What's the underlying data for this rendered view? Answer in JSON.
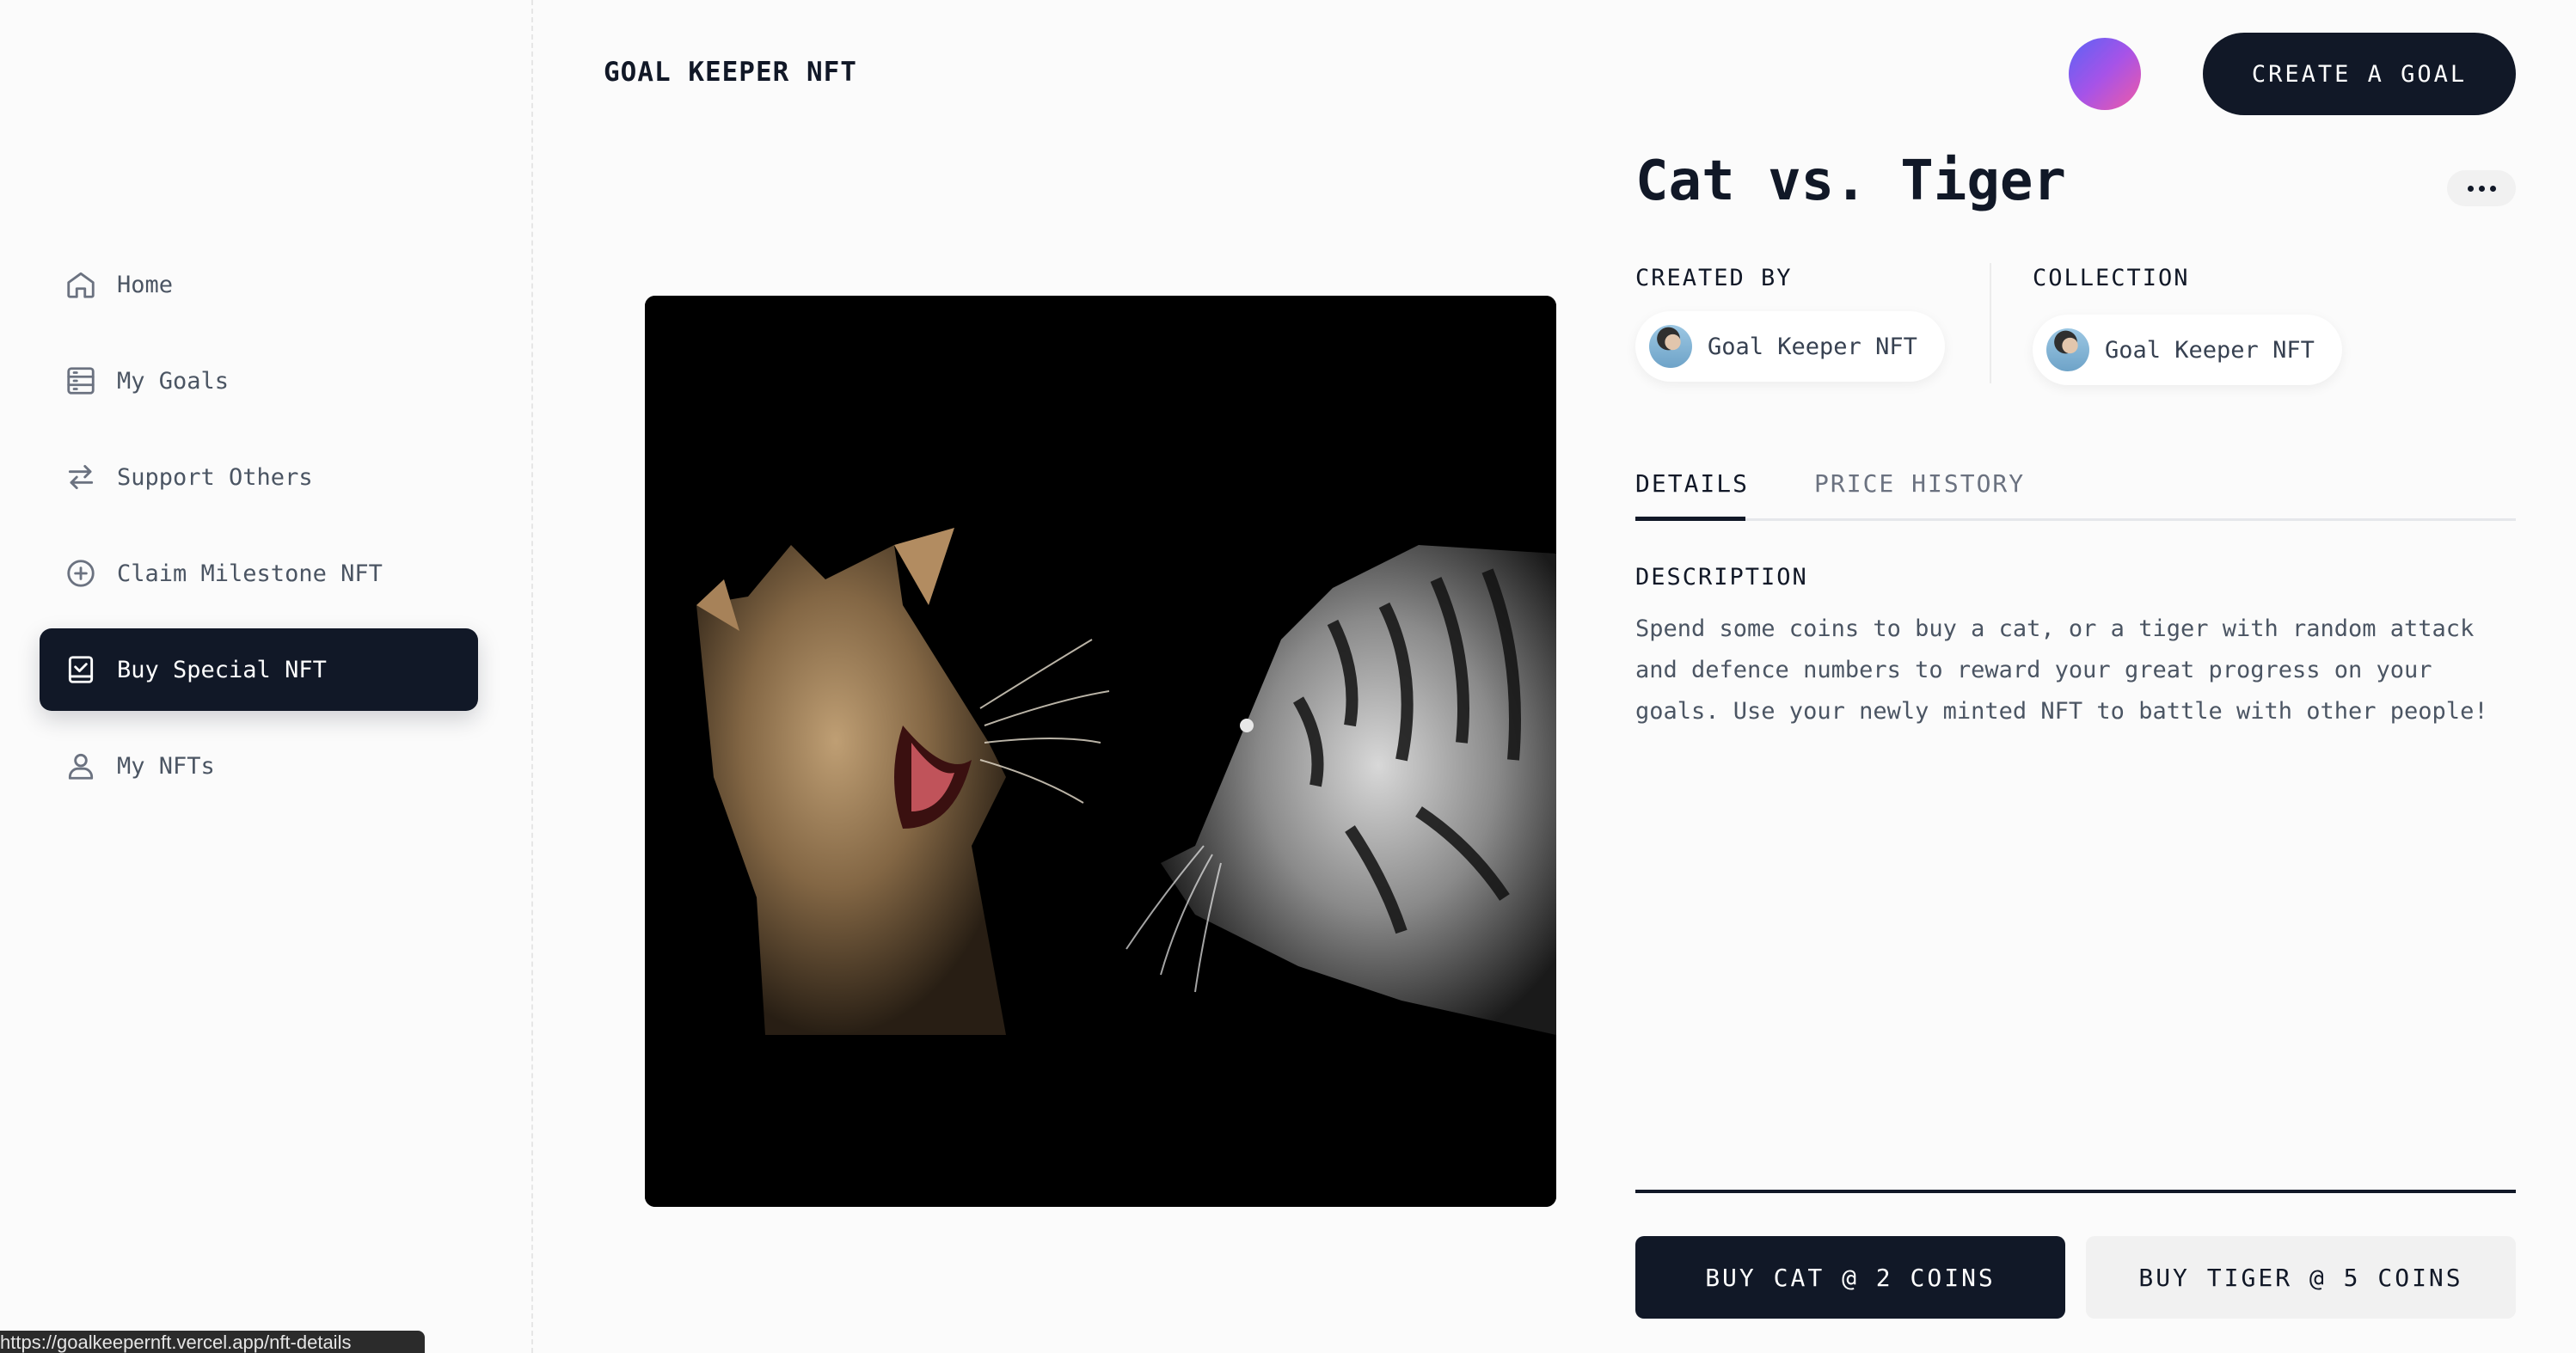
{
  "brand": "GOAL KEEPER NFT",
  "header": {
    "create_label": "CREATE A GOAL"
  },
  "sidebar": {
    "items": [
      {
        "label": "Home",
        "icon": "home-icon",
        "active": false
      },
      {
        "label": "My Goals",
        "icon": "goals-icon",
        "active": false
      },
      {
        "label": "Support Others",
        "icon": "arrows-exchange-icon",
        "active": false
      },
      {
        "label": "Claim Milestone NFT",
        "icon": "plus-circle-icon",
        "active": false
      },
      {
        "label": "Buy Special NFT",
        "icon": "check-badge-icon",
        "active": true
      },
      {
        "label": "My NFTs",
        "icon": "user-icon",
        "active": false
      }
    ]
  },
  "status_bar": {
    "url": "https://goalkeepernft.vercel.app/nft-details"
  },
  "nft": {
    "title": "Cat vs. Tiger",
    "created_by_label": "CREATED BY",
    "created_by_name": "Goal Keeper NFT",
    "collection_label": "COLLECTION",
    "collection_name": "Goal Keeper NFT"
  },
  "tabs": [
    {
      "label": "DETAILS",
      "active": true
    },
    {
      "label": "PRICE HISTORY",
      "active": false
    }
  ],
  "description": {
    "label": "DESCRIPTION",
    "text": "Spend some coins to buy a cat, or a tiger with random attack and defence numbers to reward your great progress on your goals. Use your newly minted NFT to battle with other people!"
  },
  "buy": {
    "cat_label": "BUY CAT @ 2 COINS",
    "tiger_label": "BUY TIGER @ 5 COINS"
  },
  "colors": {
    "primary": "#111827",
    "background": "#fbfbfb",
    "muted_text": "#6b7280"
  }
}
